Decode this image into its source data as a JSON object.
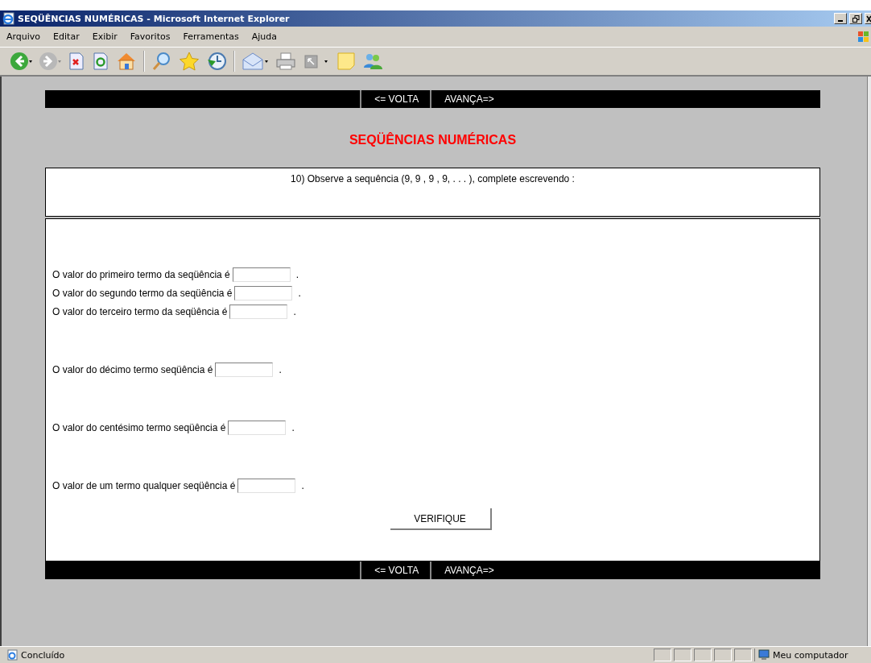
{
  "window": {
    "title": "SEQÜÊNCIAS NUMÉRICAS - Microsoft Internet Explorer"
  },
  "menu": [
    "Arquivo",
    "Editar",
    "Exibir",
    "Favoritos",
    "Ferramentas",
    "Ajuda"
  ],
  "nav_top": [
    "<= VOLTA",
    "AVANÇA=>"
  ],
  "heading": "SEQÜÊNCIAS NUMÉRICAS",
  "question": "10) Observe a sequência (9, 9 , 9 , 9, . . . ), complete escrevendo :",
  "answer_groups": [
    [
      {
        "label": "O valor do primeiro termo da seqüência é",
        "suffix": "."
      },
      {
        "label": "O valor do segundo termo da seqüência é",
        "suffix": "."
      },
      {
        "label": "O valor do terceiro termo da seqüência é",
        "suffix": "."
      }
    ],
    [
      {
        "label": "O valor do décimo termo seqüência é",
        "suffix": "."
      }
    ],
    [
      {
        "label": "O valor do centésimo termo seqüência é",
        "suffix": "."
      }
    ],
    [
      {
        "label": "O valor de um termo qualquer seqüência é",
        "suffix": "."
      }
    ]
  ],
  "submit": "VERIFIQUE",
  "nav_bottom": [
    "<= VOLTA",
    "AVANÇA=>"
  ],
  "status_bar": {
    "text": "Concluído",
    "zone": "Meu computador"
  }
}
